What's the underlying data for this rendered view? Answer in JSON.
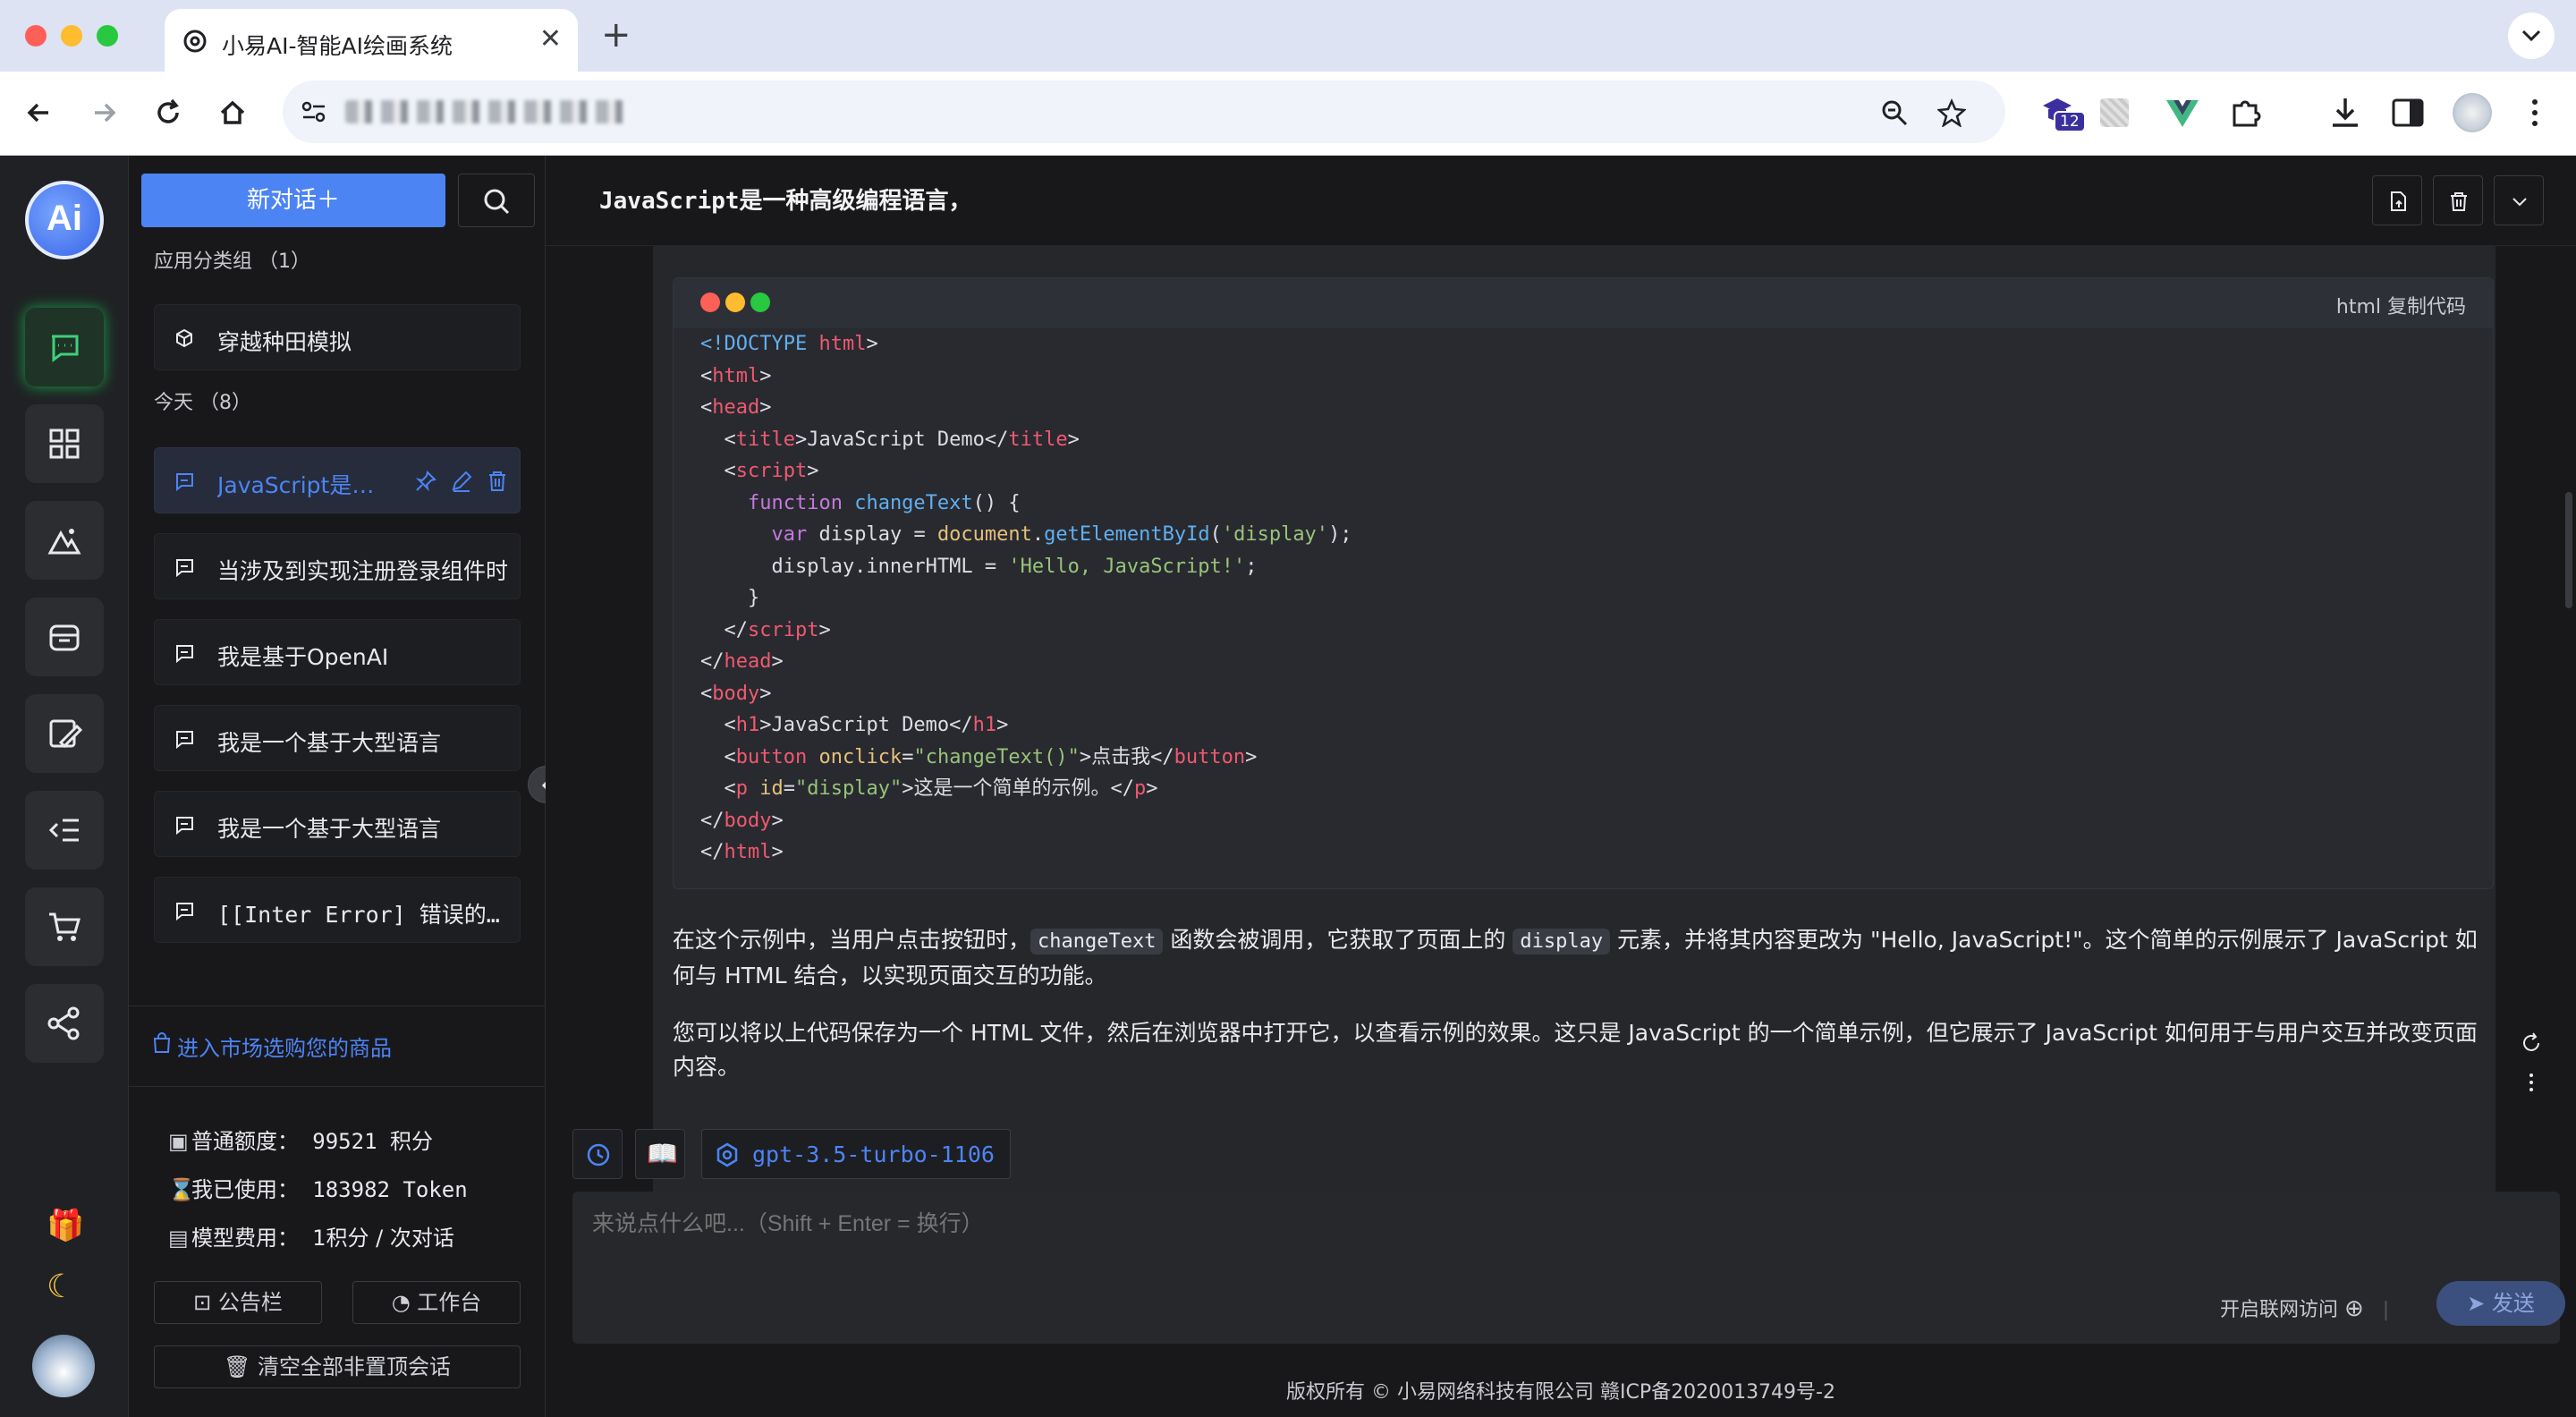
{
  "browser": {
    "tab_title": "小易AI-智能AI绘画系统",
    "new_tab": "+",
    "close": "✕",
    "ext_badge": "12"
  },
  "rail": {
    "logo_text": "Ai"
  },
  "sidebar": {
    "new_chat": "新对话＋",
    "group_apps": "应用分类组 （1）",
    "app_items": [
      {
        "label": "穿越种田模拟"
      }
    ],
    "group_today": "今天 （8）",
    "chats": [
      {
        "label": "JavaScript是一种高级编程语言，"
      },
      {
        "label": "当涉及到实现注册登录组件时"
      },
      {
        "label": "我是基于OpenAI"
      },
      {
        "label": "我是一个基于大型语言"
      },
      {
        "label": "我是一个基于大型语言"
      },
      {
        "label": "[[Inter Error] 错误的请求"
      }
    ],
    "market": "进入市场选购您的商品",
    "stats": {
      "quota_label": "普通额度：",
      "quota_value": "99521 积分",
      "used_label": "我已使用：",
      "used_value": "183982 Token",
      "fee_label": "模型费用：",
      "fee_value": "1积分 / 次对话"
    },
    "notice_btn": "公告栏",
    "workbench_btn": "工作台",
    "clear_btn": "清空全部非置顶会话"
  },
  "main": {
    "title": "JavaScript是一种高级编程语言，",
    "code_lang": "html 复制代码",
    "para1_a": "在这个示例中，当用户点击按钮时，",
    "para1_code1": "changeText",
    "para1_b": " 函数会被调用，它获取了页面上的 ",
    "para1_code2": "display",
    "para1_c": " 元素，并将其内容更改为 \"Hello, JavaScript!\"。这个简单的示例展示了 JavaScript 如何与 HTML 结合，以实现页面交互的功能。",
    "para2": "您可以将以上代码保存为一个 HTML 文件，然后在浏览器中打开它，以查看示例的效果。这只是 JavaScript 的一个简单示例，但它展示了 JavaScript 如何用于与用户交互并改变页面内容。",
    "model": "gpt-3.5-turbo-1106",
    "input_placeholder": "来说点什么吧...（Shift + Enter = 换行）",
    "net_access": "开启联网访问",
    "send": "发送",
    "footer": "版权所有 © 小易网络科技有限公司 赣ICP备2020013749号-2"
  },
  "colors": {
    "accent": "#4d84f4",
    "background": "#18181b",
    "active_green": "#19a04a"
  }
}
